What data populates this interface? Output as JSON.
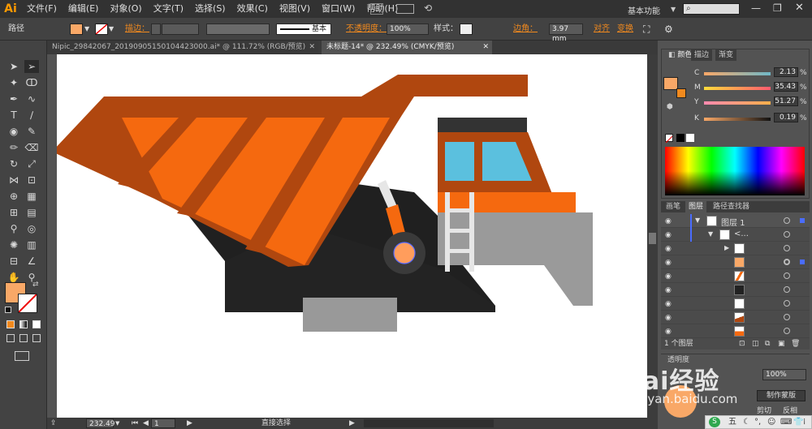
{
  "app": {
    "logo": "Ai"
  },
  "menu": [
    "文件(F)",
    "编辑(E)",
    "对象(O)",
    "文字(T)",
    "选择(S)",
    "效果(C)",
    "视图(V)",
    "窗口(W)",
    "帮助(H)"
  ],
  "workspace": {
    "label": "基本功能"
  },
  "control": {
    "selection_label": "路径",
    "stroke_label": "描边：",
    "style_label": "基本",
    "opacity_label": "不透明度：",
    "opacity_value": "100%",
    "style2_label": "样式：",
    "corner_label": "边角：",
    "corner_value": "3.97 mm",
    "align_label": "对齐",
    "transform_label": "变换"
  },
  "tabs": [
    {
      "label": "Nipic_29842067_20190905150104423000.ai* @ 111.72% (RGB/预览)"
    },
    {
      "label": "未标题-14* @ 232.49% (CMYK/预览)"
    }
  ],
  "colors": {
    "fill": "#F9A867",
    "accent": "#F28A1E"
  },
  "color_panel": {
    "tabs": [
      "颜色",
      "描边",
      "渐变"
    ],
    "channels": [
      {
        "name": "C",
        "value": "2.13"
      },
      {
        "name": "M",
        "value": "35.43"
      },
      {
        "name": "Y",
        "value": "51.27"
      },
      {
        "name": "K",
        "value": "0.19"
      }
    ],
    "unit": "%"
  },
  "layers_panel": {
    "tabs": [
      "画笔",
      "图层",
      "路径查找器"
    ],
    "layer_name": "图层 1",
    "group_name": "<...",
    "footer": "1 个图层"
  },
  "transparency_panel": {
    "tab": "透明度",
    "opacity": "100%",
    "make_mask": "制作蒙版",
    "clip": "剪切",
    "invert": "反相"
  },
  "status": {
    "zoom": "232.49",
    "page": "1",
    "tool": "直接选择"
  },
  "watermark": {
    "brand": "Bai经验",
    "url": "jingyan.baidu.com"
  },
  "ime": {
    "label": "五"
  }
}
